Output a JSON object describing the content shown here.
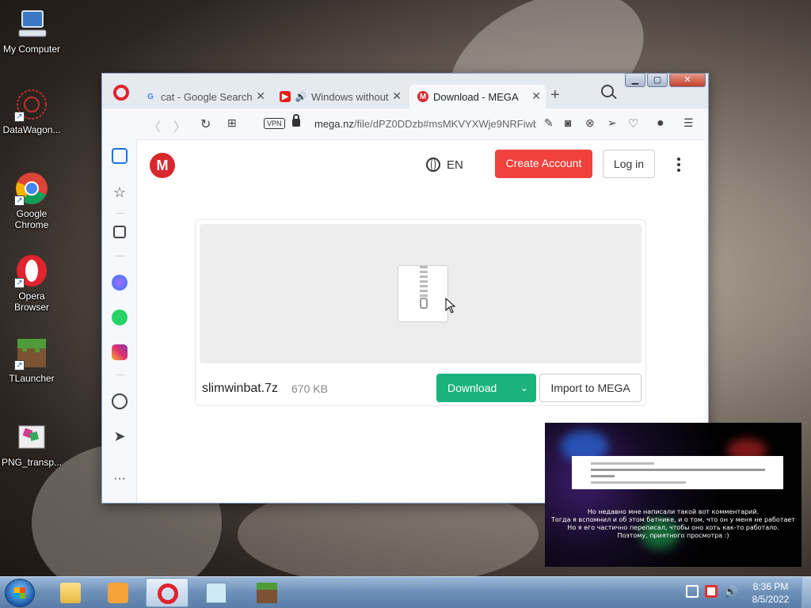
{
  "desktop": {
    "icons": [
      {
        "label": "My Computer",
        "icon": "computer-icon"
      },
      {
        "label": "DataWagon...",
        "icon": "datawagon-icon"
      },
      {
        "label": "Google Chrome",
        "icon": "chrome-icon"
      },
      {
        "label": "Opera Browser",
        "icon": "opera-icon"
      },
      {
        "label": "TLauncher",
        "icon": "tlauncher-icon"
      },
      {
        "label": "PNG_transp...",
        "icon": "png-file-icon"
      }
    ]
  },
  "browser": {
    "tabs": [
      {
        "label": "cat - Google Search",
        "favicon": "G"
      },
      {
        "label": "Windows without ",
        "favicon": "YT"
      },
      {
        "label": "Download - MEGA",
        "favicon": "M"
      }
    ],
    "vpn_label": "VPN",
    "url_host": "mega.nz",
    "url_path": "/file/dPZ0DDzb#msMKVYXWje9NRFiwb",
    "colors": {
      "opera_red": "#e0232e",
      "mega_red": "#d9272e",
      "download_green": "#1ab37c"
    }
  },
  "mega": {
    "logo": "M",
    "language": "EN",
    "create_account": "Create Account",
    "login": "Log in",
    "file_name": "slimwinbat.7z",
    "file_size": "670 KB",
    "download": "Download",
    "import": "Import to MEGA"
  },
  "video": {
    "caption_lines": [
      "Но недавно мне написали такой вот комментарий.",
      "Тогда я вспомнил и об этом батнике, и о том, что он у меня не работает",
      "Но я его частично переписал, чтобы оно хоть как-то работало.",
      "Поэтому, приятного просмотра :)"
    ]
  },
  "taskbar": {
    "time": "8:36 PM",
    "date": "8/5/2022"
  }
}
